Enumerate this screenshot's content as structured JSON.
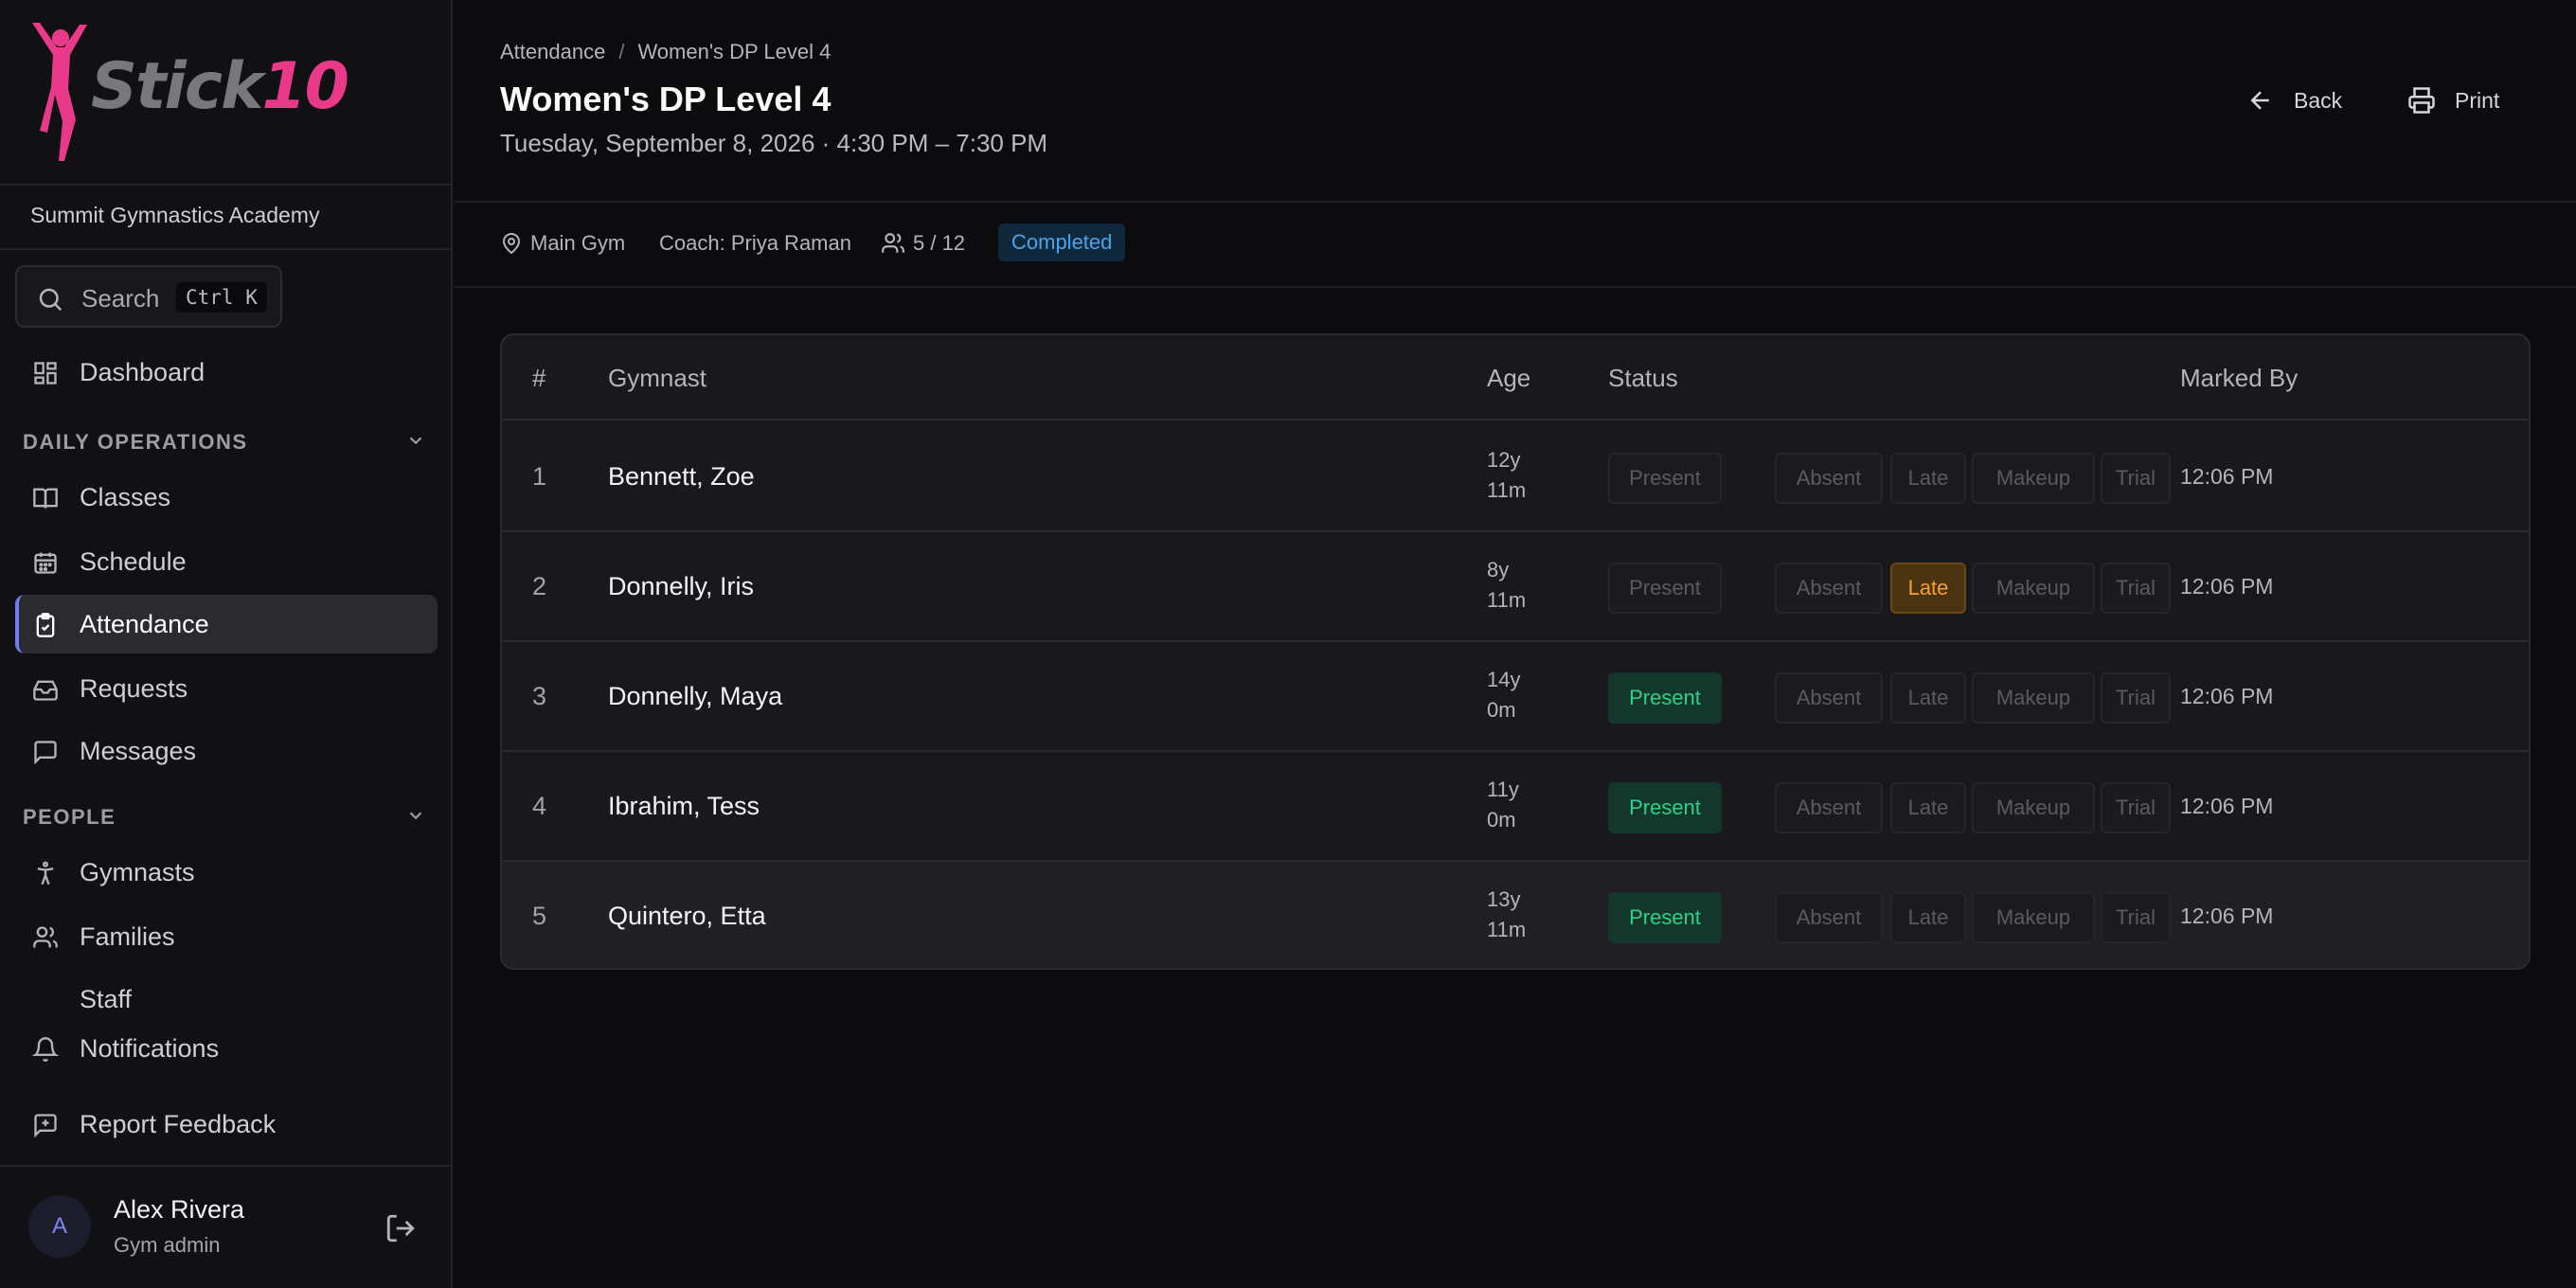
{
  "brand": {
    "stick": "Stick",
    "ten": "10"
  },
  "sidebar": {
    "org_name": "Summit Gymnastics Academy",
    "search_label": "Search",
    "search_shortcut": "Ctrl K",
    "dashboard": "Dashboard",
    "section_daily": "DAILY OPERATIONS",
    "classes": "Classes",
    "schedule": "Schedule",
    "attendance": "Attendance",
    "requests": "Requests",
    "messages": "Messages",
    "section_people": "PEOPLE",
    "gymnasts": "Gymnasts",
    "families": "Families",
    "staff": "Staff",
    "notifications": "Notifications",
    "report_feedback": "Report Feedback",
    "active_item": "Attendance",
    "accent_color": "#6f7bf7"
  },
  "user": {
    "initial": "A",
    "name": "Alex Rivera",
    "role": "Gym admin"
  },
  "header": {
    "breadcrumb": [
      "Attendance",
      "Women's DP Level 4"
    ],
    "title": "Women's DP Level 4",
    "subtitle": "Tuesday, September 8, 2026 · 4:30 PM – 7:30 PM",
    "back_label": "Back",
    "print_label": "Print"
  },
  "meta": {
    "location": "Main Gym",
    "coach": "Coach: Priya Raman",
    "count": "5 / 12",
    "status": "Completed"
  },
  "table": {
    "headers": {
      "num": "#",
      "gymnast": "Gymnast",
      "age": "Age",
      "status": "Status",
      "marked_by": "Marked By"
    },
    "status_options": [
      "Present",
      "Absent",
      "Late",
      "Makeup",
      "Trial"
    ],
    "rows": [
      {
        "num": "1",
        "name": "Bennett, Zoe",
        "age_years": "12y",
        "age_months": "11m",
        "status": "",
        "marked_by": "12:06 PM"
      },
      {
        "num": "2",
        "name": "Donnelly, Iris",
        "age_years": "8y",
        "age_months": "11m",
        "status": "Late",
        "marked_by": "12:06 PM"
      },
      {
        "num": "3",
        "name": "Donnelly, Maya",
        "age_years": "14y",
        "age_months": "0m",
        "status": "Present",
        "marked_by": "12:06 PM"
      },
      {
        "num": "4",
        "name": "Ibrahim, Tess",
        "age_years": "11y",
        "age_months": "0m",
        "status": "Present",
        "marked_by": "12:06 PM"
      },
      {
        "num": "5",
        "name": "Quintero, Etta",
        "age_years": "13y",
        "age_months": "11m",
        "status": "Present",
        "marked_by": "12:06 PM"
      }
    ]
  },
  "colors": {
    "present": "#2fd08a",
    "late": "#f3a238",
    "completed": "#47a4ee",
    "brand_pink": "#e93a8a"
  }
}
